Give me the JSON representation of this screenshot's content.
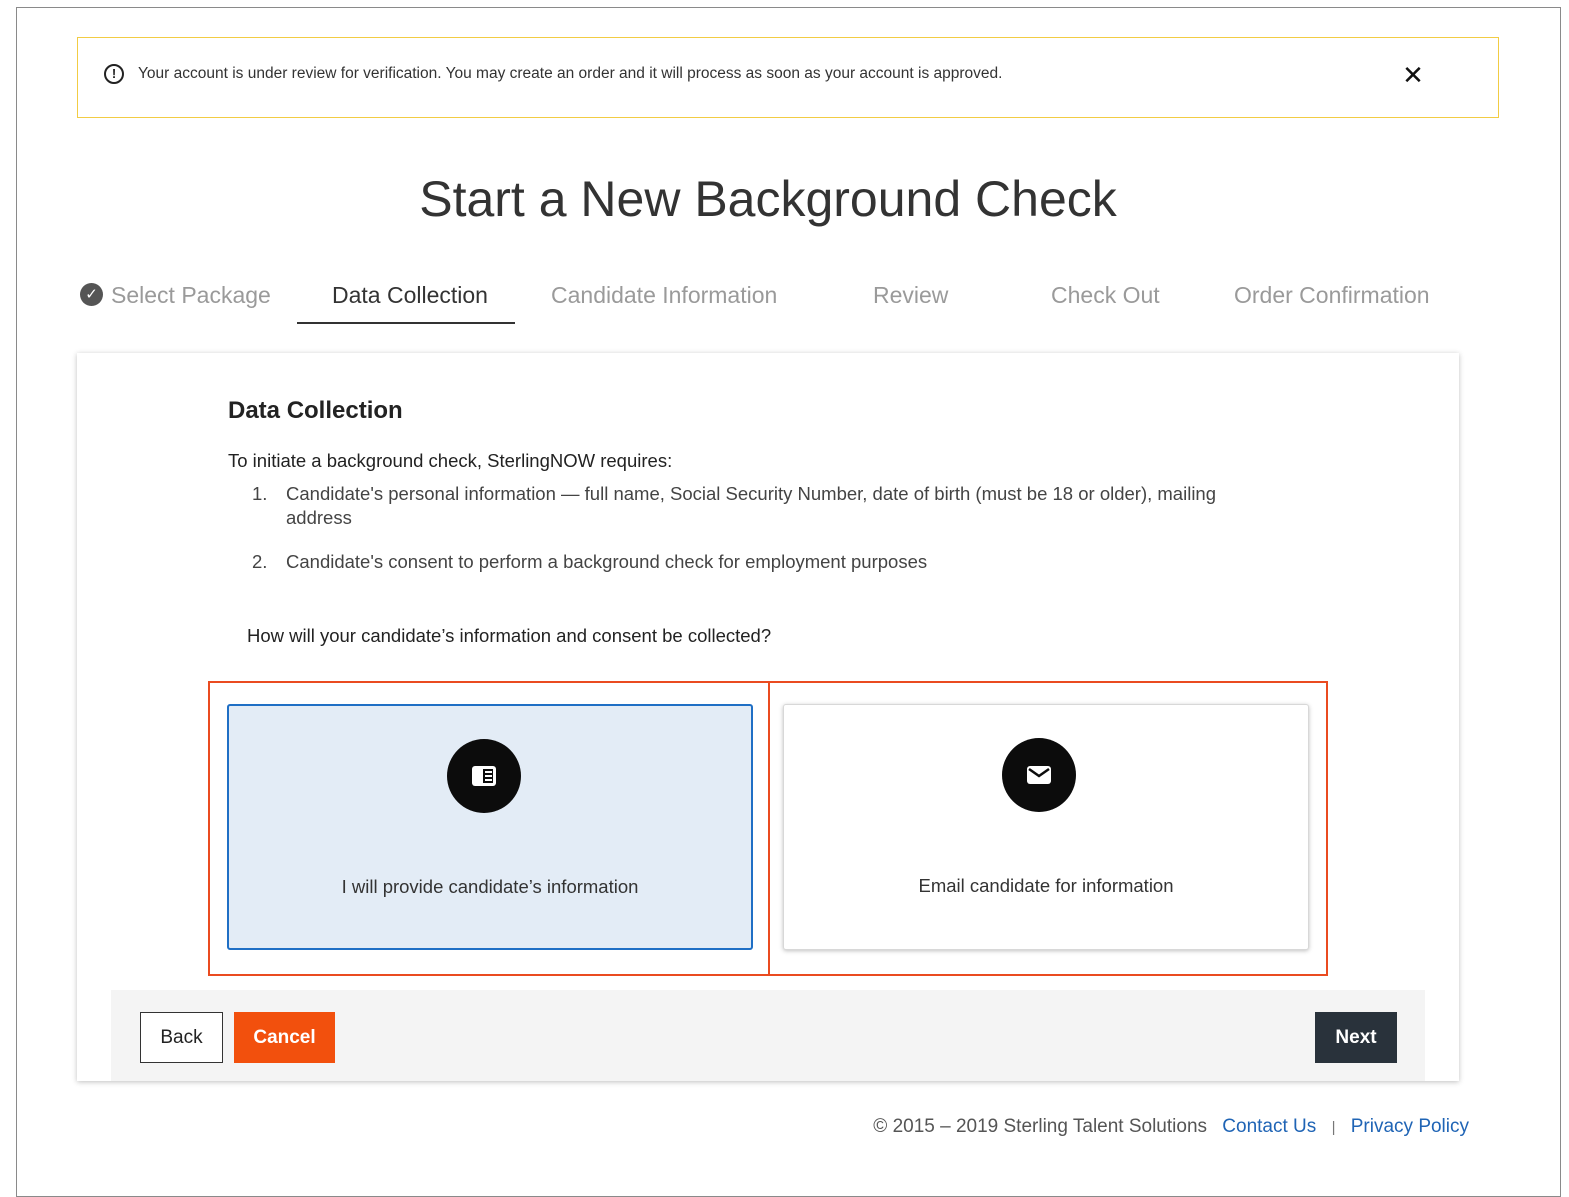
{
  "banner": {
    "message": "Your account is under review for verification. You may create an order and it will process as soon as your account is approved.",
    "info_glyph": "!",
    "close_glyph": "✕",
    "icon": "info-circle-icon",
    "border_color": "#f2cc44"
  },
  "page_title": "Start a New Background Check",
  "steps": [
    {
      "label": "Select Package",
      "state": "completed",
      "icon": "check-circle-icon"
    },
    {
      "label": "Data Collection",
      "state": "active"
    },
    {
      "label": "Candidate Information",
      "state": "upcoming"
    },
    {
      "label": "Review",
      "state": "upcoming"
    },
    {
      "label": "Check Out",
      "state": "upcoming"
    },
    {
      "label": "Order Confirmation",
      "state": "upcoming"
    }
  ],
  "step_check_glyph": "✓",
  "section": {
    "title": "Data Collection",
    "intro": "To initiate a background check, SterlingNOW requires:",
    "requirements": [
      {
        "num": "1.",
        "text": "Candidate's personal information — full name, Social Security Number, date of birth (must be 18 or older), mailing address"
      },
      {
        "num": "2.",
        "text": "Candidate's consent to perform a background check for employment purposes"
      }
    ],
    "question": "How will your candidate’s information and consent be collected?"
  },
  "options": [
    {
      "label": "I will provide candidate’s information",
      "icon": "contact-card-icon",
      "selected": true
    },
    {
      "label": "Email candidate for information",
      "icon": "envelope-icon",
      "selected": false
    }
  ],
  "buttons": {
    "back": "Back",
    "cancel": "Cancel",
    "next": "Next"
  },
  "footer": {
    "copyright": "© 2015 – 2019 Sterling Talent Solutions",
    "contact": "Contact Us",
    "separator": "|",
    "privacy": "Privacy Policy"
  },
  "colors": {
    "accent_orange": "#f2500d",
    "highlight_red": "#ea4b20",
    "selected_bg": "#e3ecf6",
    "selected_border": "#1f6fc5",
    "link_blue": "#1f64b5",
    "dark_button": "#29323b"
  }
}
